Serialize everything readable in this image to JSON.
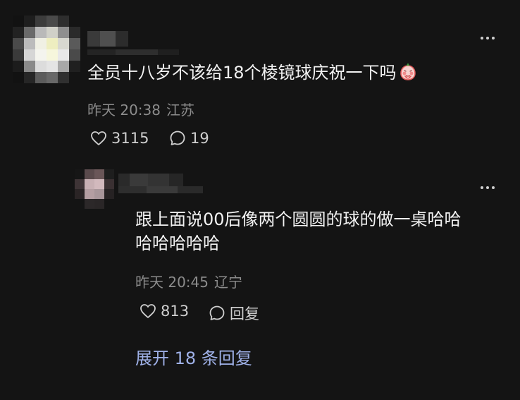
{
  "comments": [
    {
      "text": "全员十八岁不该给18个棱镜球庆祝一下吗",
      "emoji": "shy-face-emoji",
      "time": "昨天 20:38",
      "location": "江苏",
      "likes": "3115",
      "replies": "19"
    },
    {
      "text_line1": "跟上面说00后像两个圆圆的球的做一桌哈哈",
      "text_line2": "哈哈哈哈哈",
      "time": "昨天 20:45",
      "location": "辽宁",
      "likes": "813",
      "reply_label": "回复"
    }
  ],
  "expand_label": "展开 18 条回复",
  "colors": {
    "background": "#141414",
    "text": "#f2f2f2",
    "meta": "#8c8c8c",
    "link": "#9fb1e8"
  }
}
